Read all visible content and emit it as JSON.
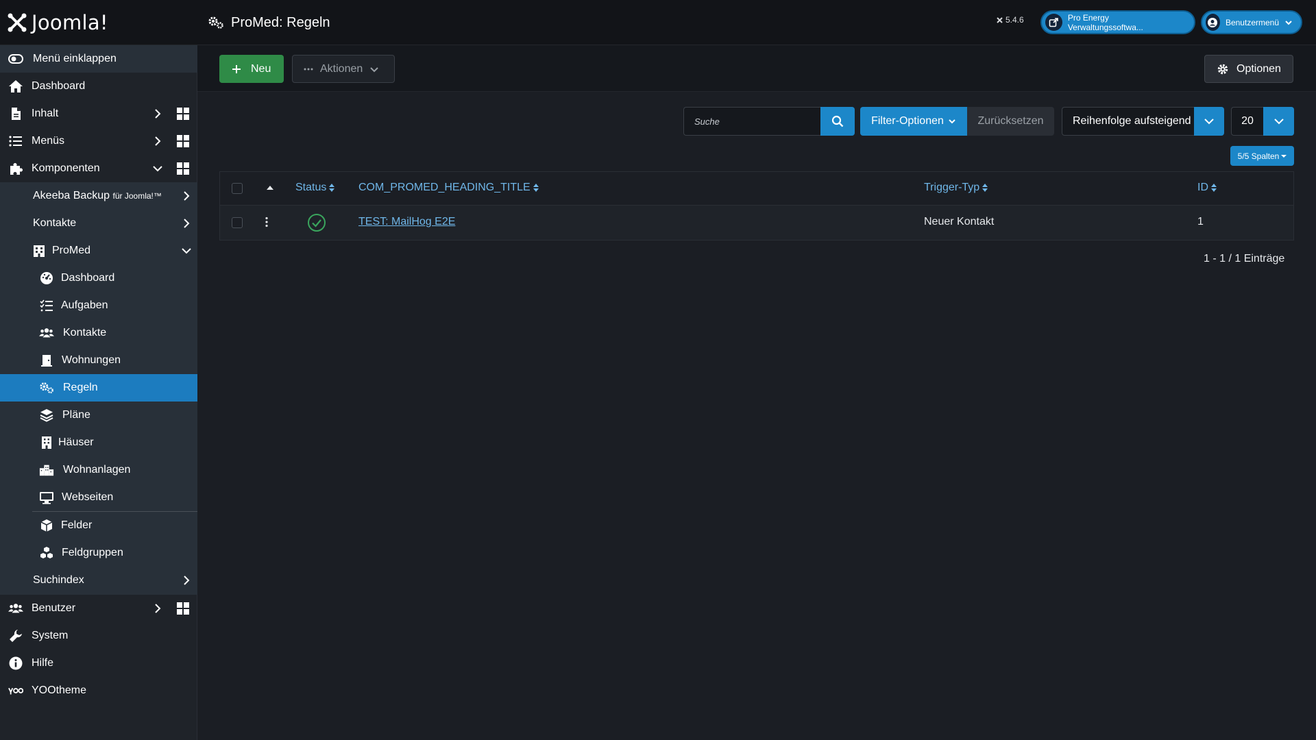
{
  "header": {
    "logo_text": "Joomla!",
    "page_title": "ProMed: Regeln",
    "version": "5.4.6",
    "site_label": "Pro Energy Verwaltungssoftwa...",
    "user_menu_label": "Benutzermenü"
  },
  "sidebar": {
    "collapse": "Menü einklappen",
    "dashboard": "Dashboard",
    "inhalt": "Inhalt",
    "menus": "Menüs",
    "komponenten": "Komponenten",
    "akeeba": "Akeeba Backup",
    "akeeba_suffix": "für Joomla!™",
    "kontakte": "Kontakte",
    "promed": "ProMed",
    "promed_items": {
      "dashboard": "Dashboard",
      "aufgaben": "Aufgaben",
      "kontakte": "Kontakte",
      "wohnungen": "Wohnungen",
      "regeln": "Regeln",
      "plaene": "Pläne",
      "haeuser": "Häuser",
      "wohnanlagen": "Wohnanlagen",
      "webseiten": "Webseiten",
      "felder": "Felder",
      "feldgruppen": "Feldgruppen"
    },
    "suchindex": "Suchindex",
    "benutzer": "Benutzer",
    "system": "System",
    "hilfe": "Hilfe",
    "yootheme": "YOOtheme"
  },
  "toolbar": {
    "new_label": "Neu",
    "actions_label": "Aktionen",
    "options_label": "Optionen"
  },
  "filters": {
    "search_placeholder": "Suche",
    "filter_options": "Filter-Optionen",
    "reset": "Zurücksetzen",
    "ordering": "Reihenfolge aufsteigend",
    "limit": "20",
    "columns": "5/5 Spalten"
  },
  "table": {
    "headers": {
      "status": "Status",
      "title": "COM_PROMED_HEADING_TITLE",
      "trigger": "Trigger-Typ",
      "id": "ID"
    },
    "rows": [
      {
        "title": "TEST: MailHog E2E",
        "trigger": "Neuer Kontakt",
        "id": "1",
        "status": "published"
      }
    ]
  },
  "pagination": "1 - 1 / 1 Einträge",
  "colors": {
    "accent": "#1c87c9",
    "success": "#2f8b47",
    "link": "#6fb6e8"
  }
}
